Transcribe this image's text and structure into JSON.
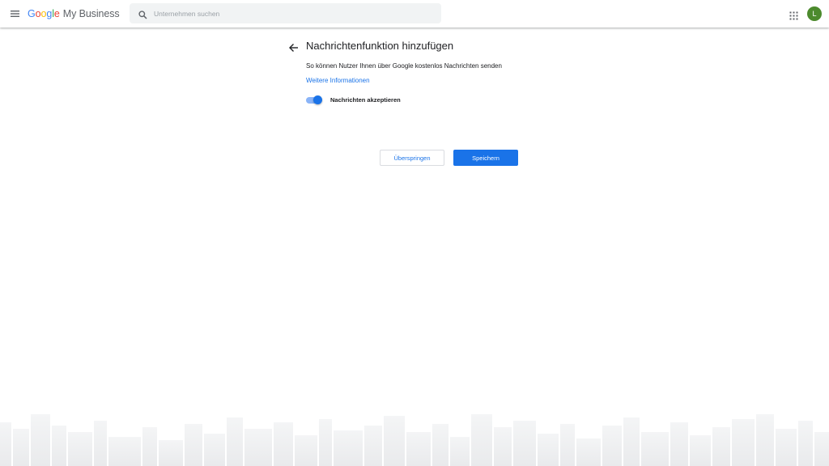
{
  "header": {
    "logo": {
      "google_letters": [
        "G",
        "o",
        "o",
        "g",
        "l",
        "e"
      ],
      "product": "My Business"
    },
    "search": {
      "placeholder": "Unternehmen suchen",
      "value": ""
    },
    "avatar_initial": "L",
    "icons": {
      "menu": "menu-icon",
      "search": "search-icon",
      "apps": "apps-grid-icon"
    }
  },
  "main": {
    "title": "Nachrichtenfunktion hinzufügen",
    "description": "So können Nutzer Ihnen über Google kostenlos Nachrichten senden",
    "more_link": "Weitere Informationen",
    "toggle": {
      "label": "Nachrichten akzeptieren",
      "on": true
    },
    "buttons": {
      "skip": "Überspringen",
      "save": "Speichern"
    }
  },
  "colors": {
    "primary": "#1a73e8",
    "toggle_track": "#8ab4f8",
    "avatar": "#4c8a2d",
    "search_bg": "#f1f3f4"
  }
}
